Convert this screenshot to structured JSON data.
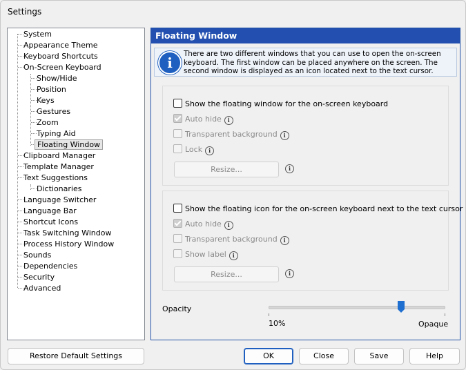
{
  "window": {
    "title": "Settings"
  },
  "tree": {
    "items": [
      {
        "label": "System"
      },
      {
        "label": "Appearance Theme"
      },
      {
        "label": "Keyboard Shortcuts"
      },
      {
        "label": "On-Screen Keyboard"
      },
      {
        "label": "Show/Hide"
      },
      {
        "label": "Position"
      },
      {
        "label": "Keys"
      },
      {
        "label": "Gestures"
      },
      {
        "label": "Zoom"
      },
      {
        "label": "Typing Aid"
      },
      {
        "label": "Floating Window"
      },
      {
        "label": "Clipboard Manager"
      },
      {
        "label": "Template Manager"
      },
      {
        "label": "Text Suggestions"
      },
      {
        "label": "Dictionaries"
      },
      {
        "label": "Language Switcher"
      },
      {
        "label": "Language Bar"
      },
      {
        "label": "Shortcut Icons"
      },
      {
        "label": "Task Switching Window"
      },
      {
        "label": "Process History Window"
      },
      {
        "label": "Sounds"
      },
      {
        "label": "Dependencies"
      },
      {
        "label": "Security"
      },
      {
        "label": "Advanced"
      }
    ]
  },
  "panel": {
    "title": "Floating Window",
    "info": "There are two different windows that you can use to open the on-screen keyboard. The first window can be placed anywhere on the screen. The second window is displayed as an icon located next to the text cursor.",
    "group1": {
      "main": "Show the floating window for the on-screen keyboard",
      "auto_hide": "Auto hide",
      "transparent": "Transparent background",
      "lock": "Lock",
      "resize": "Resize..."
    },
    "group2": {
      "main": "Show the floating icon for the on-screen keyboard next to the text cursor",
      "auto_hide": "Auto hide",
      "transparent": "Transparent background",
      "show_label": "Show label",
      "resize": "Resize..."
    },
    "opacity": {
      "label": "Opacity",
      "min_label": "10%",
      "max_label": "Opaque",
      "value_fraction": 0.76
    }
  },
  "buttons": {
    "restore": "Restore Default Settings",
    "ok": "OK",
    "close": "Close",
    "save": "Save",
    "help": "Help"
  },
  "colors": {
    "accent": "#2350b0",
    "info_icon": "#1f5fbf",
    "slider_thumb": "#1f6fd0"
  }
}
